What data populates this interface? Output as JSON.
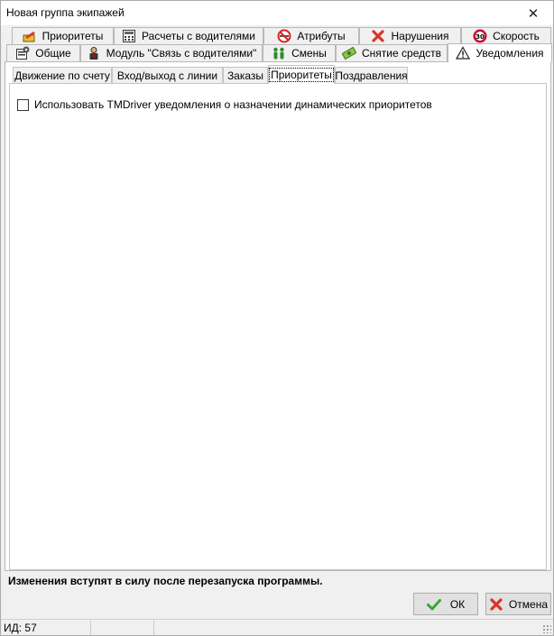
{
  "window": {
    "title": "Новая группа экипажей",
    "close_glyph": "✕"
  },
  "tabs_row1": [
    {
      "label": "Приоритеты",
      "icon": "priority-icon"
    },
    {
      "label": "Расчеты с водителями",
      "icon": "calculator-icon"
    },
    {
      "label": "Атрибуты",
      "icon": "no-smoking-icon"
    },
    {
      "label": "Нарушения",
      "icon": "red-x-icon"
    },
    {
      "label": "Скорость",
      "icon": "speed-limit-icon",
      "icon_text": "30"
    }
  ],
  "tabs_row2": [
    {
      "label": "Общие",
      "icon": "properties-icon"
    },
    {
      "label": "Модуль \"Связь с водителями\"",
      "icon": "driver-icon"
    },
    {
      "label": "Смены",
      "icon": "people-icon"
    },
    {
      "label": "Снятие средств",
      "icon": "money-icon"
    },
    {
      "label": "Уведомления",
      "icon": "warning-icon",
      "active": true
    }
  ],
  "subtabs": [
    {
      "label": "Движение по счету"
    },
    {
      "label": "Вход/выход с линии"
    },
    {
      "label": "Заказы"
    },
    {
      "label": "Приоритеты",
      "active": true
    },
    {
      "label": "Поздравления"
    }
  ],
  "content": {
    "checkbox_label": "Использовать TMDriver уведомления о назначении динамических приоритетов",
    "checked": false
  },
  "notice": "Изменения вступят в силу после перезапуска программы.",
  "buttons": {
    "ok": "ОК",
    "cancel": "Отмена"
  },
  "status": {
    "id_text": "ИД: 57"
  },
  "colors": {
    "ok_check": "#3aa635",
    "cancel_x": "#d9342b",
    "speed_badge": "#c8102e"
  }
}
